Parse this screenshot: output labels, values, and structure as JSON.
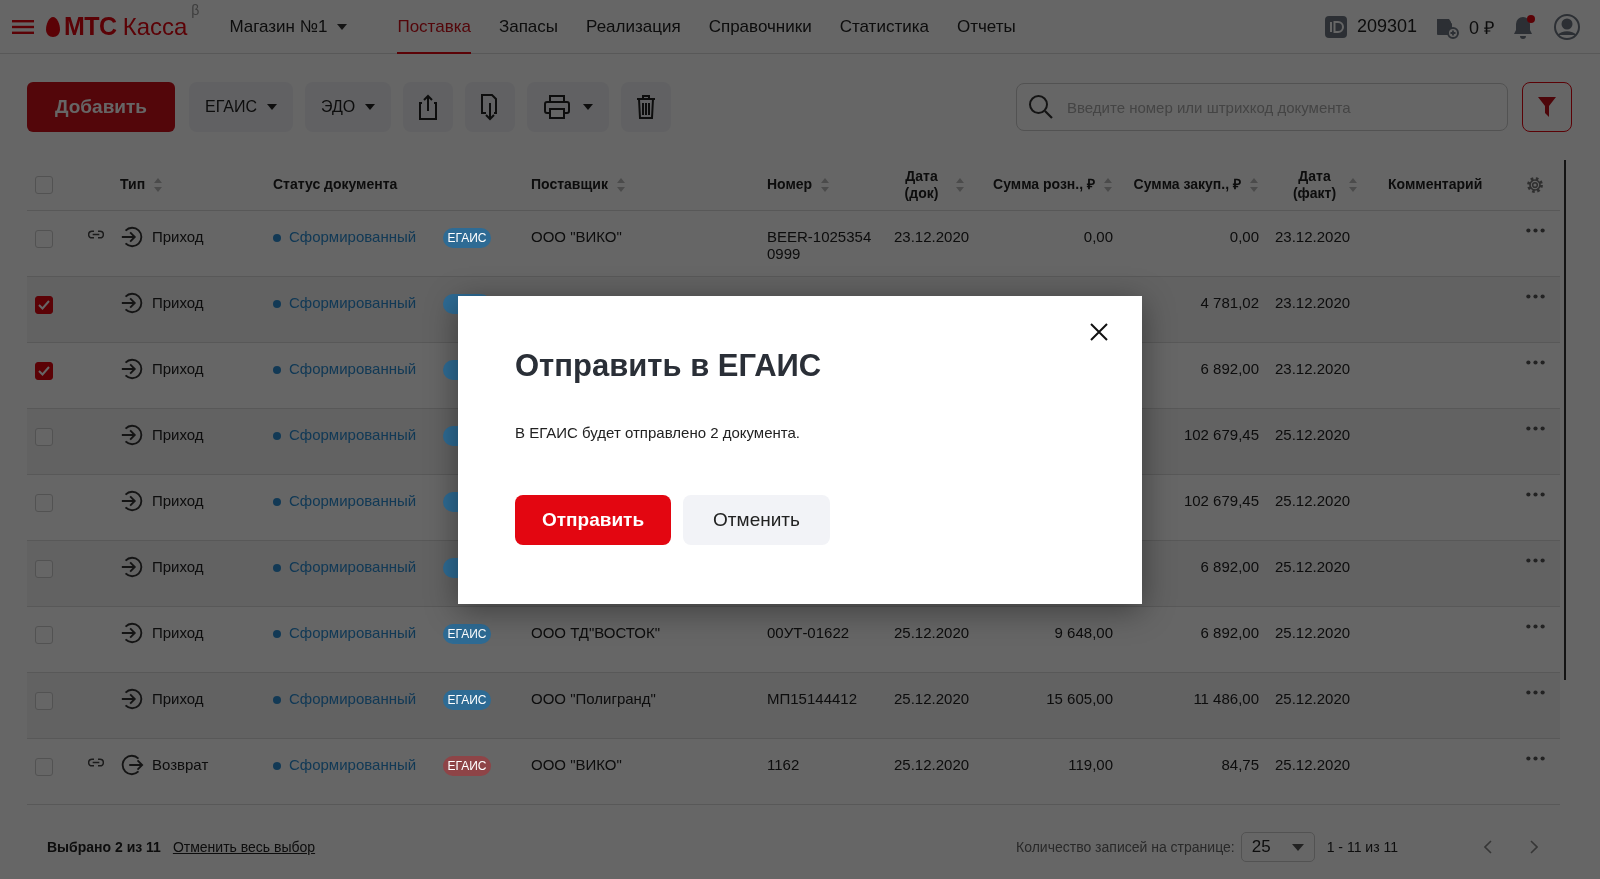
{
  "header": {
    "logo": {
      "brand": "МТС",
      "product": "Касса",
      "mark": "β"
    },
    "store": "Магазин №1",
    "nav": [
      {
        "label": "Поставка",
        "selected": true
      },
      {
        "label": "Запасы",
        "selected": false
      },
      {
        "label": "Реализация",
        "selected": false
      },
      {
        "label": "Справочники",
        "selected": false
      },
      {
        "label": "Статистика",
        "selected": false
      },
      {
        "label": "Отчеты",
        "selected": false
      }
    ],
    "id": "209301",
    "balance": "0 ₽",
    "has_notifications": true
  },
  "toolbar": {
    "add": "Добавить",
    "menus": [
      "ЕГАИС",
      "ЭДО"
    ],
    "search": {
      "placeholder": "Введите номер или штрихкод документа"
    }
  },
  "table": {
    "all_checked": false,
    "columns": [
      {
        "label": "Тип",
        "sortable": true
      },
      {
        "label": "Статус документа",
        "sortable": false
      },
      {
        "label": "Поставщик",
        "sortable": true
      },
      {
        "label": "Номер",
        "sortable": true
      },
      {
        "label": "Дата (док)",
        "sortable": true
      },
      {
        "label": "Сумма розн., ₽",
        "sortable": true
      },
      {
        "label": "Сумма закуп., ₽",
        "sortable": true
      },
      {
        "label": "Дата (факт)",
        "sortable": true
      },
      {
        "label": "Комментарий",
        "sortable": false
      }
    ],
    "rows": [
      {
        "checked": false,
        "linked": true,
        "kind": "incoming",
        "type": "Приход",
        "status": "Сформированный",
        "badge": {
          "text": "ЕГАИС",
          "color": "#2e6b94"
        },
        "supplier": "ООО \"ВИКО\"",
        "number": "BEER-1025354 0999",
        "date_doc": "23.12.2020",
        "sum_retail": "0,00",
        "sum_purchase": "0,00",
        "date_fact": "23.12.2020"
      },
      {
        "checked": true,
        "linked": false,
        "kind": "incoming",
        "type": "Приход",
        "status": "Сформированный",
        "badge": {
          "color": "#2e6b94"
        },
        "sum_purchase": "4 781,02",
        "date_fact": "23.12.2020"
      },
      {
        "checked": true,
        "linked": false,
        "kind": "incoming",
        "type": "Приход",
        "status": "Сформированный",
        "badge": {
          "color": "#2e6b94"
        },
        "sum_purchase": "6 892,00",
        "date_fact": "23.12.2020"
      },
      {
        "checked": false,
        "linked": false,
        "kind": "incoming",
        "type": "Приход",
        "status": "Сформированный",
        "badge": {
          "color": "#2e6b94"
        },
        "sum_purchase": "102 679,45",
        "date_fact": "25.12.2020"
      },
      {
        "checked": false,
        "linked": false,
        "kind": "incoming",
        "type": "Приход",
        "status": "Сформированный",
        "badge": {
          "color": "#2e6b94"
        },
        "sum_purchase": "102 679,45",
        "date_fact": "25.12.2020"
      },
      {
        "checked": false,
        "linked": false,
        "kind": "incoming",
        "type": "Приход",
        "status": "Сформированный",
        "badge": {
          "color": "#2e6b94"
        },
        "sum_purchase": "6 892,00",
        "date_fact": "25.12.2020"
      },
      {
        "checked": false,
        "linked": false,
        "kind": "incoming",
        "type": "Приход",
        "status": "Сформированный",
        "badge": {
          "text": "ЕГАИС",
          "color": "#2e6b94"
        },
        "supplier": "ООО ТД\"ВОСТОК\"",
        "number": "00УТ-01622",
        "date_doc": "25.12.2020",
        "sum_retail": "9 648,00",
        "sum_purchase": "6 892,00",
        "date_fact": "25.12.2020"
      },
      {
        "checked": false,
        "linked": false,
        "kind": "incoming",
        "type": "Приход",
        "status": "Сформированный",
        "badge": {
          "text": "ЕГАИС",
          "color": "#2e6b94"
        },
        "supplier": "ООО \"Полигранд\"",
        "number": "МП15144412",
        "date_doc": "25.12.2020",
        "sum_retail": "15 605,00",
        "sum_purchase": "11 486,00",
        "date_fact": "25.12.2020"
      },
      {
        "checked": false,
        "linked": true,
        "kind": "return",
        "type": "Возврат",
        "status": "Сформированный",
        "badge": {
          "text": "ЕГАИС",
          "color": "#8e4447"
        },
        "supplier": "ООО \"ВИКО\"",
        "number": "1162",
        "date_doc": "25.12.2020",
        "sum_retail": "119,00",
        "sum_purchase": "84,75",
        "date_fact": "25.12.2020"
      }
    ]
  },
  "footer": {
    "selected": "Выбрано 2 из 11",
    "clear": "Отменить весь выбор",
    "per_page_label": "Количество записей на странице:",
    "per_page": "25",
    "range": "1 - 11 из 11"
  },
  "dialog": {
    "title": "Отправить в ЕГАИС",
    "message": "В ЕГАИС будет отправлено 2 документа.",
    "buttons": [
      {
        "label": "Отправить",
        "kind": "primary"
      },
      {
        "label": "Отменить",
        "kind": "secondary"
      }
    ]
  }
}
